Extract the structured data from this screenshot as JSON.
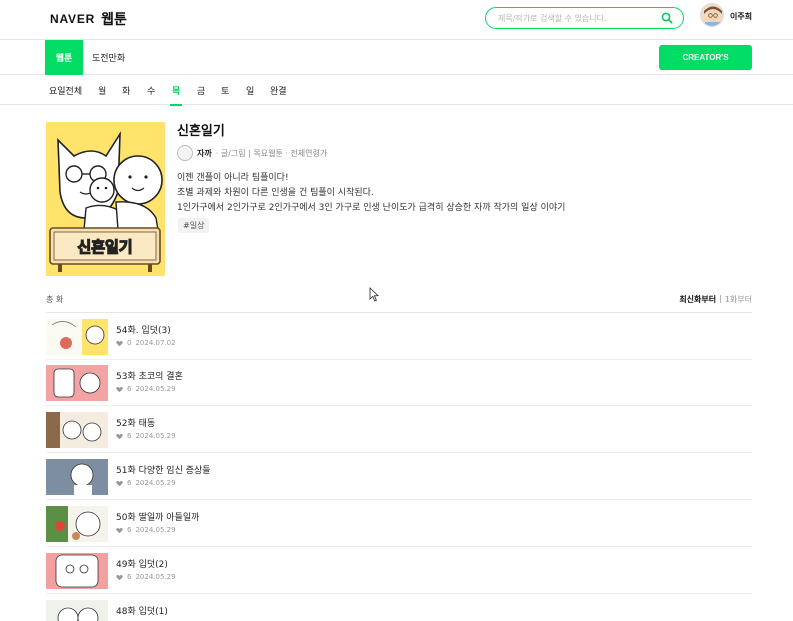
{
  "header": {
    "logo_naver": "NAVER",
    "logo_webtoon": "웹툰",
    "search_placeholder": "제목/작가로 검색할 수 있습니다.",
    "user_name": "이주희"
  },
  "subnav": {
    "webtoon_tab": "웹툰",
    "challenge_tab": "도전만화",
    "creators_button": "CREATOR'S"
  },
  "days": [
    "요일전체",
    "월",
    "화",
    "수",
    "목",
    "금",
    "토",
    "일",
    "완결"
  ],
  "active_day": "목",
  "webtoon": {
    "title": "신혼일기",
    "author": "자까",
    "meta": "· 글/그림 | 목요웹툰 · 전체연령가",
    "description": [
      "이젠 갠플이 아니라 팀플이다!",
      "조별 과제와 차원이 다른 인생을 건 팀플이 시작된다.",
      "1인가구에서 2인가구로 2인가구에서 3인 가구로 인생 난이도가 급격히 상승한 자까 작가의 일상 이야기"
    ],
    "tag": "#일상",
    "cover_text": "신혼일기"
  },
  "list": {
    "total_label": "총 화",
    "sort_latest": "최신화부터",
    "sort_divider": "|",
    "sort_first": "1화부터"
  },
  "episodes": [
    {
      "title": "54화. 입덧(3)",
      "likes": "0",
      "date": "2024.07.02"
    },
    {
      "title": "53화 초코의 결혼",
      "likes": "6",
      "date": "2024.05.29"
    },
    {
      "title": "52화 태동",
      "likes": "6",
      "date": "2024.05.29"
    },
    {
      "title": "51화 다양한 임신 증상들",
      "likes": "6",
      "date": "2024.05.29"
    },
    {
      "title": "50화 딸일까 아들일까",
      "likes": "6",
      "date": "2024.05.29"
    },
    {
      "title": "49화 입덧(2)",
      "likes": "6",
      "date": "2024.05.29"
    },
    {
      "title": "48화 입덧(1)",
      "likes": "",
      "date": ""
    }
  ],
  "colors": {
    "brand_green": "#00dc64"
  }
}
